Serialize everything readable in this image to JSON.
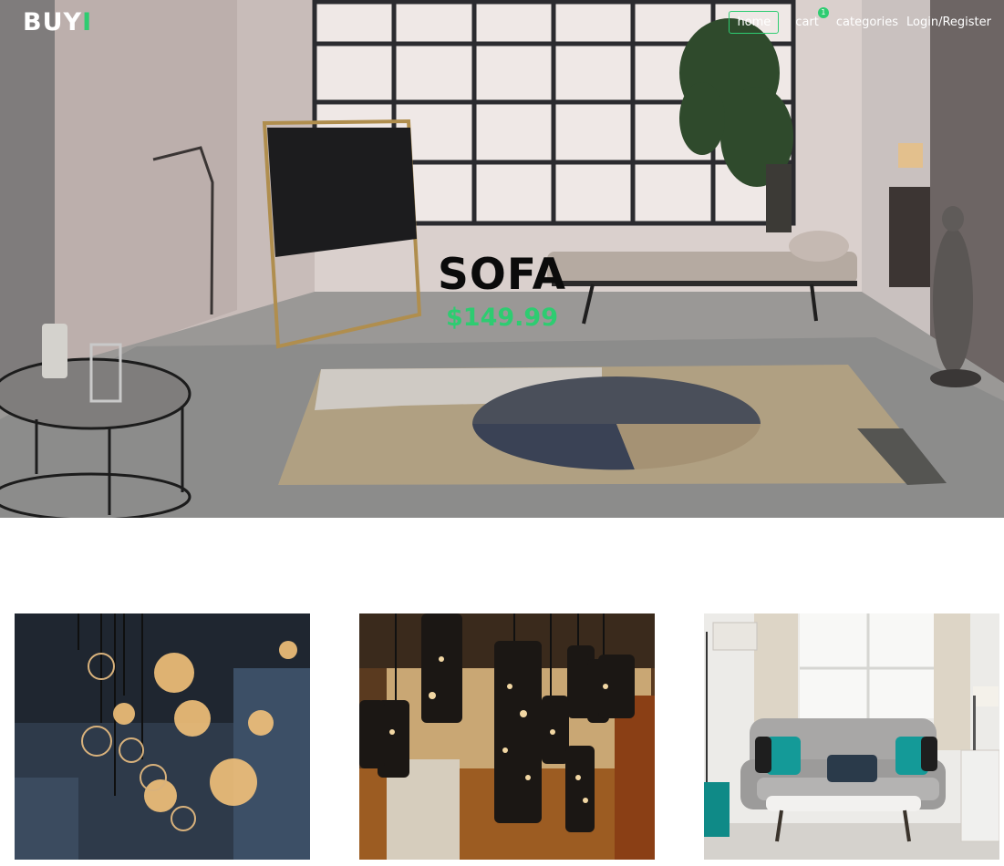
{
  "header": {
    "logo_text": "BUY",
    "logo_accent": "I",
    "nav": {
      "home": "home",
      "cart": "cart",
      "cart_count": "1",
      "categories": "categories",
      "login": "Login/Register"
    }
  },
  "hero": {
    "title": "SOFA",
    "price": "$149.99"
  },
  "colors": {
    "accent": "#2ecc71",
    "title": "#0b0b0b",
    "nav_text": "#ffffff"
  },
  "products": [
    {
      "image": "pendant-bulbs-photo"
    },
    {
      "image": "perforated-lamps-photo"
    },
    {
      "image": "grey-sofa-room-photo"
    }
  ]
}
